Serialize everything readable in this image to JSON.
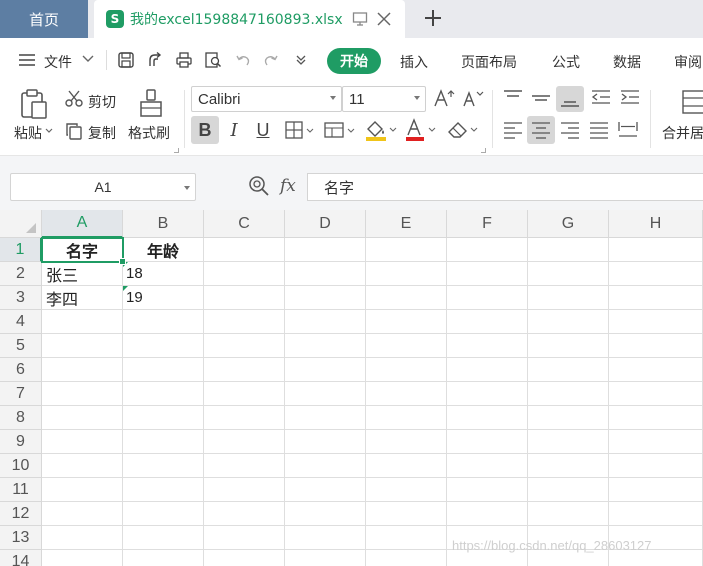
{
  "tabs": {
    "home_label": "首页",
    "file_icon_letter": "S",
    "file_name": "我的excel1598847160893.xlsx"
  },
  "menu": {
    "file_label": "文件",
    "items": [
      "开始",
      "插入",
      "页面布局",
      "公式",
      "数据",
      "审阅"
    ]
  },
  "ribbon": {
    "paste_label": "粘贴",
    "cut_label": "剪切",
    "copy_label": "复制",
    "format_painter_label": "格式刷",
    "font_name": "Calibri",
    "font_size": "11",
    "bold_glyph": "B",
    "italic_glyph": "I",
    "underline_glyph": "U",
    "merge_label": "合并居"
  },
  "formula_bar": {
    "name_box": "A1",
    "fx_label": "fx",
    "content": "名字"
  },
  "grid": {
    "columns": [
      "A",
      "B",
      "C",
      "D",
      "E",
      "F",
      "G",
      "H"
    ],
    "rows": [
      "1",
      "2",
      "3",
      "4",
      "5",
      "6",
      "7",
      "8",
      "9",
      "10",
      "11",
      "12",
      "13",
      "14"
    ],
    "cells": {
      "A1": "名字",
      "B1": "年龄",
      "A2": "张三",
      "B2": "18",
      "A3": "李四",
      "B3": "19"
    },
    "selected_cell": "A1"
  },
  "colors": {
    "accent": "#1f9c64",
    "home_tab": "#5d7ea3",
    "tab_bar": "#e9eaee"
  },
  "watermark": "https://blog.csdn.net/qq_28603127"
}
